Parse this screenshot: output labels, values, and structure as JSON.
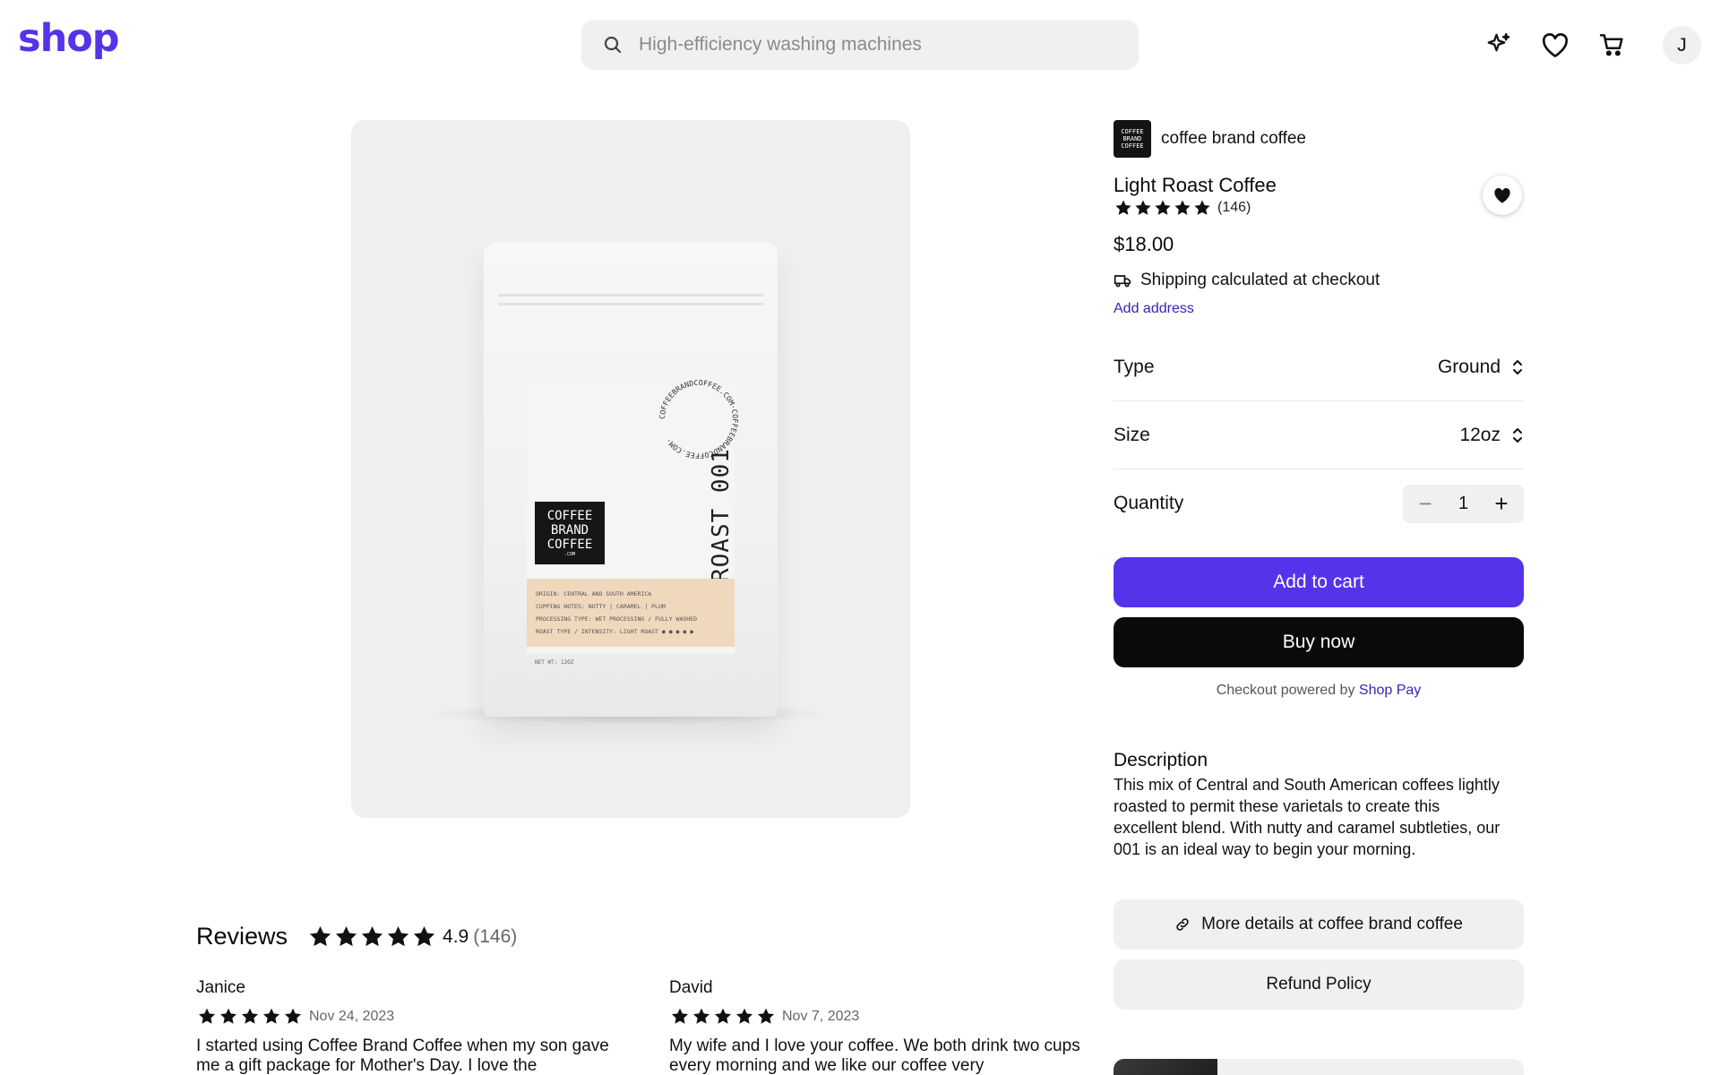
{
  "header": {
    "logo": "shop",
    "search_placeholder": "High-efficiency washing machines",
    "icons": [
      "search-icon",
      "sparkle-icon",
      "heart-icon",
      "cart-icon"
    ],
    "avatar_initial": "J"
  },
  "product_image": {
    "brand_block": "COFFEE BRAND COFFEE",
    "brand_sub": ".COM",
    "roast_text": "ROAST 001",
    "seal_text": "COFFEEBRANDCOFFEE.COM·COFFEEBRANDCOFFEE.COM·",
    "label_lines": [
      "ORIGIN: CENTRAL AND SOUTH AMERICA",
      "CUPPING NOTES: NUTTY | CARAMEL | PLUM",
      "PROCESSING TYPE: WET PROCESSING / FULLY WASHED",
      "ROAST TYPE / INTENSITY: LIGHT ROAST  ● ● ● ● ●"
    ],
    "net_weight": "NET WT: 12OZ"
  },
  "product": {
    "shop_logo_text": "COFFEE BRAND COFFEE",
    "shop_name": "coffee brand coffee",
    "title": "Light Roast Coffee",
    "rating_stars": 5,
    "review_count": "(146)",
    "price": "$18.00",
    "shipping_text": "Shipping calculated at checkout",
    "add_address": "Add address",
    "options": [
      {
        "label": "Type",
        "value": "Ground"
      },
      {
        "label": "Size",
        "value": "12oz"
      }
    ],
    "quantity_label": "Quantity",
    "quantity_value": "1",
    "minus_symbol": "−",
    "plus_symbol": "+",
    "add_to_cart": "Add to cart",
    "buy_now": "Buy now",
    "powered_prefix": "Checkout powered by",
    "powered_link": "Shop Pay",
    "description_title": "Description",
    "description_body": "This mix of Central and South American coffees lightly roasted to permit these varietals to create this excellent blend. With nutty and caramel subtleties, our 001 is an ideal way to begin your morning.",
    "more_details": "More details at coffee brand coffee",
    "refund_policy": "Refund Policy"
  },
  "reviews": {
    "heading": "Reviews",
    "average": "4.9",
    "count": "(146)",
    "items": [
      {
        "name": "Janice",
        "date": "Nov 24, 2023",
        "text": "I started using Coffee Brand Coffee when my son gave me a gift package for Mother's Day. I love the"
      },
      {
        "name": "David",
        "date": "Nov 7, 2023",
        "text": "My wife and I love your coffee. We both drink two cups every morning and we like our coffee very"
      }
    ]
  },
  "colors": {
    "brand": "#5433eb",
    "link": "#3a23b8",
    "dark_button": "#0a0a0a",
    "light_surface": "#f0f0f1",
    "bag_label": "#f0d8bd"
  }
}
